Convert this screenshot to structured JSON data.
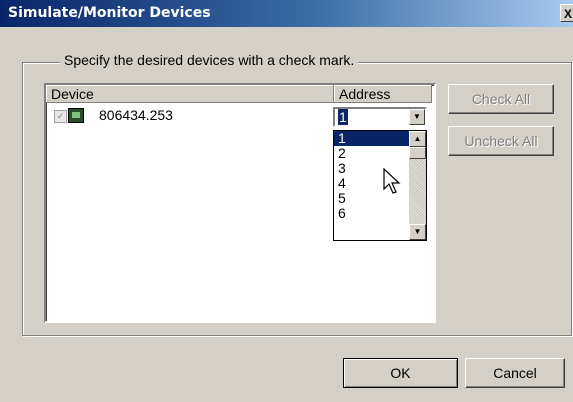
{
  "window": {
    "title": "Simulate/Monitor Devices",
    "close_label": "X"
  },
  "group": {
    "legend": "Specify the desired devices with a check mark."
  },
  "list": {
    "columns": [
      "Device",
      "Address"
    ],
    "rows": [
      {
        "name": "806434.253",
        "checked": true
      }
    ]
  },
  "combo": {
    "value": "1"
  },
  "dropdown": {
    "options": [
      "1",
      "2",
      "3",
      "4",
      "5",
      "6"
    ],
    "selected": "1"
  },
  "buttons": {
    "check_all": "Check All",
    "uncheck_all": "Uncheck All",
    "ok": "OK",
    "cancel": "Cancel"
  },
  "icons": {
    "checkbox": "checkbox-icon",
    "device": "device-icon",
    "cursor": "arrow-cursor-icon"
  }
}
